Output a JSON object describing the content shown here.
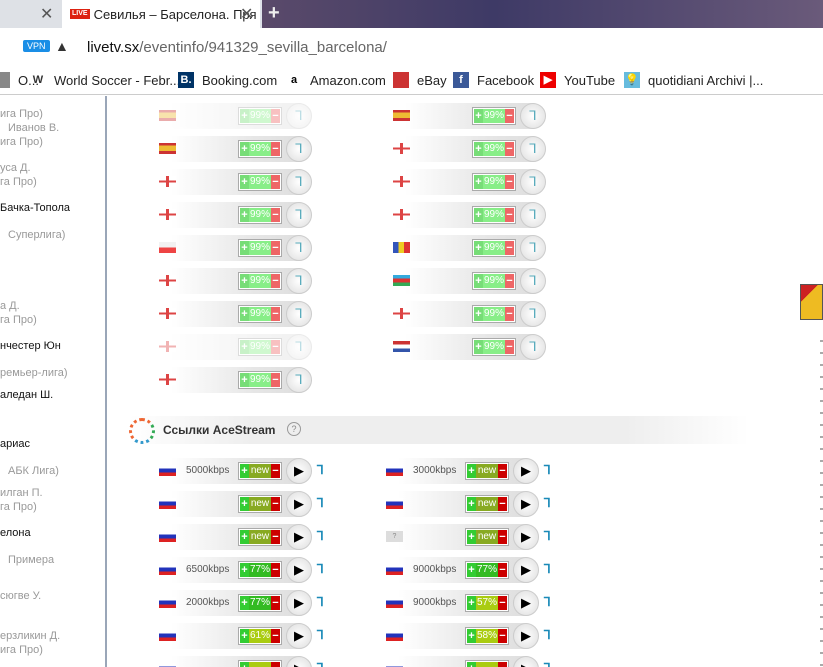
{
  "browser": {
    "tabs": [
      {
        "label": ""
      },
      {
        "badge": "LIVE",
        "label": "Севилья – Барселона. Пря"
      }
    ],
    "url_host": "livetv.sx",
    "url_path": "/eventinfo/941329_sevilla_barcelona/",
    "vpn": "VPN",
    "bookmarks": [
      {
        "label": "O...",
        "icon": "globe-icon"
      },
      {
        "label": "World Soccer - Febr...",
        "icon": "ws-icon"
      },
      {
        "label": "Booking.com",
        "icon": "booking-icon"
      },
      {
        "label": "Amazon.com",
        "icon": "amazon-icon"
      },
      {
        "label": "eBay",
        "icon": "ebay-icon"
      },
      {
        "label": "Facebook",
        "icon": "facebook-icon"
      },
      {
        "label": "YouTube",
        "icon": "youtube-icon"
      },
      {
        "label": "quotidiani Archivi |...",
        "icon": "bulb-icon"
      }
    ]
  },
  "sidebar": {
    "items": [
      {
        "text": "ига Про)",
        "em": false
      },
      {
        "text": "Иванов В.",
        "em": false
      },
      {
        "text": "ига Про)",
        "em": false
      },
      {
        "text": "уса Д.",
        "em": false
      },
      {
        "text": "га Про)",
        "em": false
      },
      {
        "text": "Бачка-Топола",
        "em": true
      },
      {
        "text": "Суперлига)",
        "em": false
      },
      {
        "text": "а Д.",
        "em": false
      },
      {
        "text": "га Про)",
        "em": false
      },
      {
        "text": "нчестер Юн",
        "em": true
      },
      {
        "text": "ремьер-лига)",
        "em": false
      },
      {
        "text": "аледан Ш.",
        "em": true
      },
      {
        "text": "ариас",
        "em": true
      },
      {
        "text": "АБК Лига)",
        "em": false
      },
      {
        "text": "илган П.",
        "em": false
      },
      {
        "text": "га Про)",
        "em": false
      },
      {
        "text": "елона",
        "em": true
      },
      {
        "text": "Примера",
        "em": false
      },
      {
        "text": "сюгве У.",
        "em": false
      },
      {
        "text": "ерзликин Д.",
        "em": false
      },
      {
        "text": "ига Про)",
        "em": false
      }
    ]
  },
  "broadcast_links": {
    "left": [
      {
        "flag": "es",
        "rating": "99%",
        "faded": true
      },
      {
        "flag": "es",
        "rating": "99%"
      },
      {
        "flag": "en",
        "rating": "99%"
      },
      {
        "flag": "en",
        "rating": "99%"
      },
      {
        "flag": "pl",
        "rating": "99%"
      },
      {
        "flag": "en",
        "rating": "99%"
      },
      {
        "flag": "en",
        "rating": "99%"
      },
      {
        "flag": "en",
        "rating": "99%",
        "faded": true
      },
      {
        "flag": "en",
        "rating": "99%"
      }
    ],
    "right": [
      {
        "flag": "es",
        "rating": "99%"
      },
      {
        "flag": "en",
        "rating": "99%"
      },
      {
        "flag": "en",
        "rating": "99%"
      },
      {
        "flag": "en",
        "rating": "99%"
      },
      {
        "flag": "ro",
        "rating": "99%"
      },
      {
        "flag": "az",
        "rating": "99%"
      },
      {
        "flag": "en",
        "rating": "99%"
      },
      {
        "flag": "nl",
        "rating": "99%"
      }
    ]
  },
  "acestream": {
    "title": "Ссылки AceStream",
    "help": "?",
    "left": [
      {
        "flag": "ru",
        "kbps": "5000kbps",
        "rating": "new"
      },
      {
        "flag": "ru",
        "kbps": "",
        "rating": "new"
      },
      {
        "flag": "ru",
        "kbps": "",
        "rating": "new"
      },
      {
        "flag": "ru",
        "kbps": "6500kbps",
        "rating": "77%"
      },
      {
        "flag": "ru",
        "kbps": "2000kbps",
        "rating": "77%"
      },
      {
        "flag": "ru",
        "kbps": "",
        "rating": "61%"
      },
      {
        "flag": "ru",
        "kbps": "",
        "rating": ""
      }
    ],
    "right": [
      {
        "flag": "ru",
        "kbps": "3000kbps",
        "rating": "new"
      },
      {
        "flag": "ru",
        "kbps": "",
        "rating": "new"
      },
      {
        "flag": "unknown",
        "kbps": "",
        "rating": "new"
      },
      {
        "flag": "ru",
        "kbps": "9000kbps",
        "rating": "77%"
      },
      {
        "flag": "ru",
        "kbps": "9000kbps",
        "rating": "57%"
      },
      {
        "flag": "ru",
        "kbps": "",
        "rating": "58%"
      },
      {
        "flag": "ru",
        "kbps": "",
        "rating": ""
      }
    ]
  },
  "flag_colors": {
    "es": "linear-gradient(#c33 25%,#eb3 25%,#eb3 75%,#c33 75%)",
    "en": "linear-gradient(90deg,transparent 40%,#d44 40%,#d44 60%,transparent 60%),linear-gradient(#fff 40%,#d44 40%,#d44 60%,#fff 60%)",
    "pl": "linear-gradient(#f2f2f2 50%,#e44 50%)",
    "ro": "linear-gradient(90deg,#35b 33%,#ec2 33%,#ec2 66%,#d33 66%)",
    "az": "linear-gradient(#3ad 33%,#d33 33%,#d33 66%,#3a5 66%)",
    "nl": "linear-gradient(#c33 33%,#fff 33%,#fff 66%,#35a 66%)",
    "ru": "linear-gradient(#fff 33%,#23b 33%,#23b 66%,#d22 66%)",
    "unknown": "#ddd"
  }
}
